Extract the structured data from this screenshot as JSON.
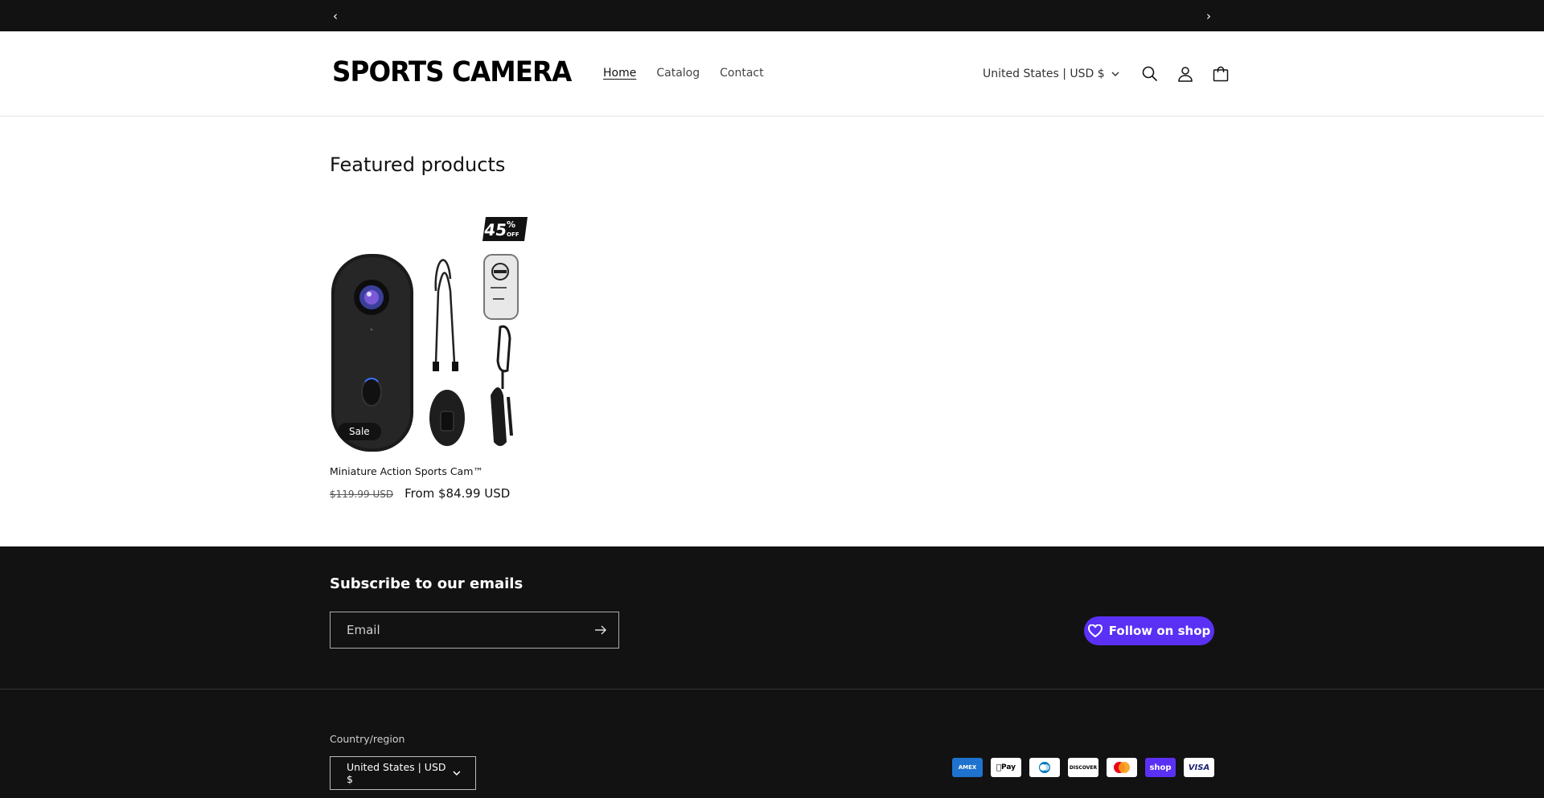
{
  "announcement": {
    "prev": "‹",
    "next": "›"
  },
  "header": {
    "logo": "SPORTS CAMERA",
    "nav": [
      {
        "label": "Home",
        "active": true
      },
      {
        "label": "Catalog",
        "active": false
      },
      {
        "label": "Contact",
        "active": false
      }
    ],
    "locale": "United States | USD $"
  },
  "featured": {
    "title": "Featured products",
    "product": {
      "name": "Miniature Action Sports Cam™",
      "badge": "Sale",
      "discount_label": "45% OFF",
      "price_old": "$119.99 USD",
      "price_new": "From $84.99 USD"
    }
  },
  "footer": {
    "subscribe_title": "Subscribe to our emails",
    "email_placeholder": "Email",
    "follow_label": "Follow on shop",
    "country_label": "Country/region",
    "country_value": "United States | USD $",
    "payments": [
      {
        "name": "American Express",
        "short": "AMEX",
        "bg": "#1f72cd",
        "fg": "#ffffff"
      },
      {
        "name": "Apple Pay",
        "short": "Pay",
        "bg": "#ffffff",
        "fg": "#000000"
      },
      {
        "name": "Diners Club",
        "short": "DC",
        "bg": "#ffffff",
        "fg": "#0079be"
      },
      {
        "name": "Discover",
        "short": "DISCOVER",
        "bg": "#ffffff",
        "fg": "#000000"
      },
      {
        "name": "Mastercard",
        "short": "MC",
        "bg": "#ffffff",
        "fg": "#eb001b"
      },
      {
        "name": "Shop Pay",
        "short": "shop",
        "bg": "#5a31f4",
        "fg": "#ffffff"
      },
      {
        "name": "Visa",
        "short": "VISA",
        "bg": "#ffffff",
        "fg": "#1a1f71"
      }
    ]
  },
  "colors": {
    "bg_dark": "#121212",
    "shop_purple": "#5a31f4"
  }
}
